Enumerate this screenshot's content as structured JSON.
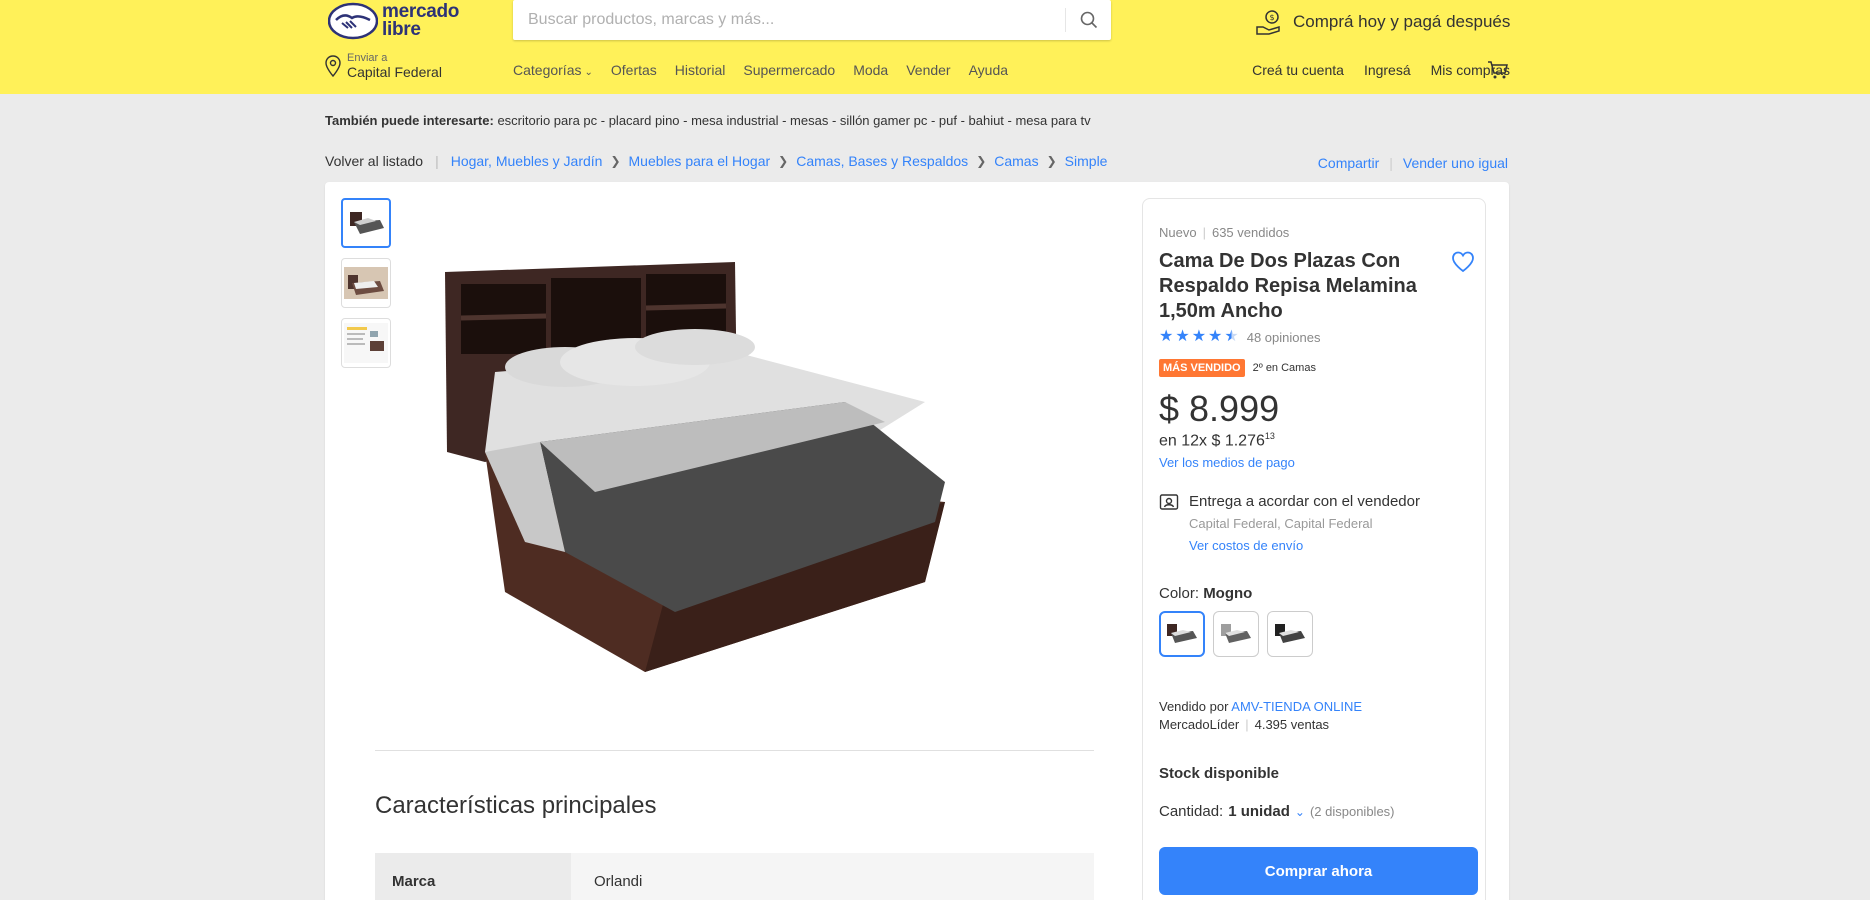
{
  "header": {
    "logo_text_line1": "mercado",
    "logo_text_line2": "libre",
    "search_placeholder": "Buscar productos, marcas y más...",
    "promo_text": "Comprá hoy y pagá después",
    "location_small": "Enviar a",
    "location_big": "Capital Federal",
    "nav": [
      "Categorías",
      "Ofertas",
      "Historial",
      "Supermercado",
      "Moda",
      "Vender",
      "Ayuda"
    ],
    "account_nav": [
      "Creá tu cuenta",
      "Ingresá",
      "Mis compras"
    ],
    "brand_color": "#fff159"
  },
  "interest": {
    "label": "También puede interesarte:",
    "items": "escritorio para pc - placard pino - mesa industrial - mesas - sillón gamer pc - puf - bahiut - mesa para tv"
  },
  "breadcrumb": {
    "back": "Volver al listado",
    "items": [
      "Hogar, Muebles y Jardín",
      "Muebles para el Hogar",
      "Camas, Bases y Respaldos",
      "Camas",
      "Simple"
    ],
    "share": "Compartir",
    "sell": "Vender uno igual"
  },
  "product": {
    "condition": "Nuevo",
    "sold": "635 vendidos",
    "title": "Cama De Dos Plazas Con Respaldo Repisa Melamina 1,50m Ancho",
    "rating_value": 4.5,
    "reviews": "48 opiniones",
    "badge": "MÁS VENDIDO",
    "rank": "2º en Camas",
    "price": "$ 8.999",
    "installments_prefix": "en 12x $ 1.276",
    "installments_cents": "13",
    "payment_link": "Ver los medios de pago",
    "shipping_title": "Entrega a acordar con el vendedor",
    "shipping_location": "Capital Federal, Capital Federal",
    "shipping_link": "Ver costos de envío",
    "color_label": "Color: ",
    "color_value": "Mogno",
    "seller_prefix": "Vendido por ",
    "seller_name": "AMV-TIENDA ONLINE",
    "seller_level": "MercadoLíder",
    "seller_sales": "4.395 ventas",
    "stock": "Stock disponible",
    "qty_label": "Cantidad: ",
    "qty_value": "1 unidad",
    "qty_available": "(2 disponibles)",
    "buy_button": "Comprar ahora",
    "accent_color": "#3483fa",
    "badge_color": "#ff7733"
  },
  "features": {
    "title": "Características principales",
    "rows": [
      {
        "key": "Marca",
        "value": "Orlandi"
      }
    ]
  }
}
